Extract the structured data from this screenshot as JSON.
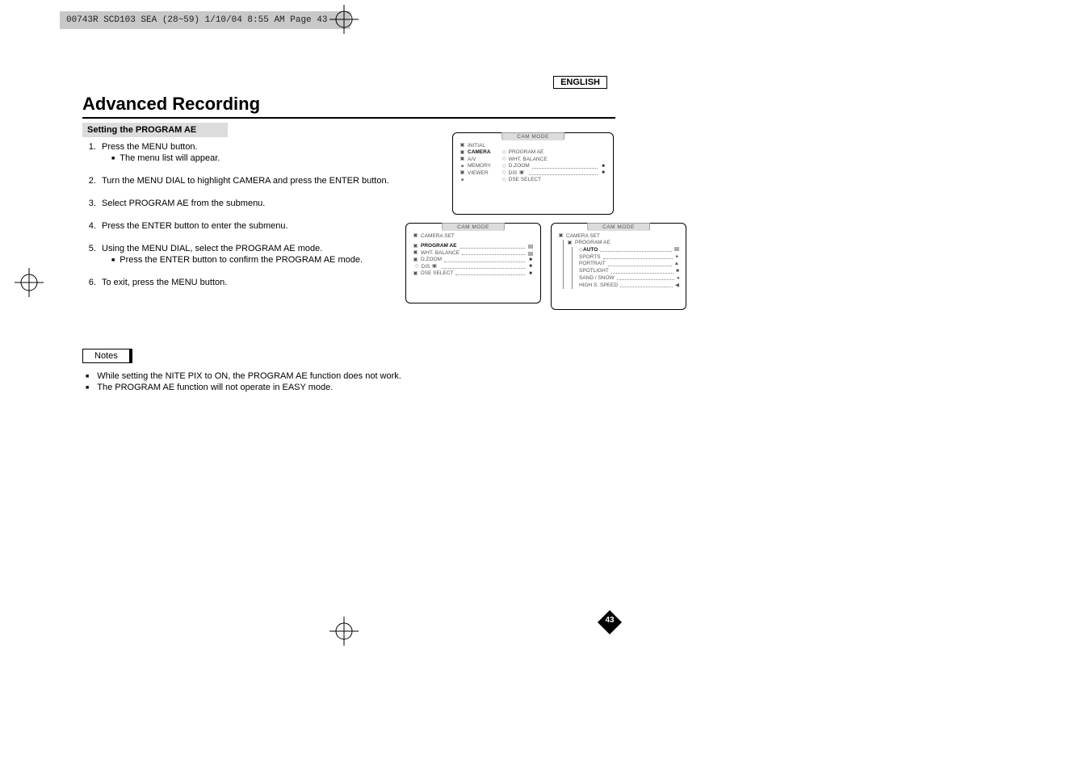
{
  "header_strip": "00743R SCD103 SEA (28~59)  1/10/04 8:55 AM  Page 43",
  "lang_tag": "ENGLISH",
  "title": "Advanced Recording",
  "section_heading": "Setting the PROGRAM AE",
  "steps": [
    {
      "text": "Press the MENU button.",
      "sub": [
        "The menu list will appear."
      ]
    },
    {
      "text": "Turn the MENU DIAL to highlight CAMERA and press the ENTER button.",
      "sub": []
    },
    {
      "text": "Select PROGRAM AE from the submenu.",
      "sub": []
    },
    {
      "text": "Press the ENTER button to enter the submenu.",
      "sub": []
    },
    {
      "text": "Using the MENU DIAL, select the PROGRAM AE mode.",
      "sub": [
        "Press the ENTER button to confirm the PROGRAM AE mode."
      ]
    },
    {
      "text": "To exit, press the MENU button.",
      "sub": []
    }
  ],
  "notes_label": "Notes",
  "notes": [
    "While setting the NITE PIX to ON, the PROGRAM AE function does not work.",
    "The PROGRAM AE function will not operate in EASY mode."
  ],
  "osd": {
    "mode_label": "CAM  MODE",
    "screen1": {
      "left_col": [
        "INITIAL",
        "CAMERA",
        "A/V",
        "MEMORY",
        "VIEWER"
      ],
      "right_col": [
        "PROGRAM AE",
        "WHT. BALANCE",
        "D.ZOOM",
        "DIS",
        "DSE SELECT"
      ]
    },
    "screen2": {
      "heading": "CAMERA SET",
      "items": [
        "PROGRAM AE",
        "WHT. BALANCE",
        "D.ZOOM",
        "DIS",
        "DSE SELECT"
      ]
    },
    "screen3": {
      "heading": "CAMERA SET",
      "subheading": "PROGRAM AE",
      "items": [
        "AUTO",
        "SPORTS",
        "PORTRAIT",
        "SPOTLIGHT",
        "SAND / SNOW",
        "HIGH S. SPEED"
      ]
    }
  },
  "page_number": "43"
}
